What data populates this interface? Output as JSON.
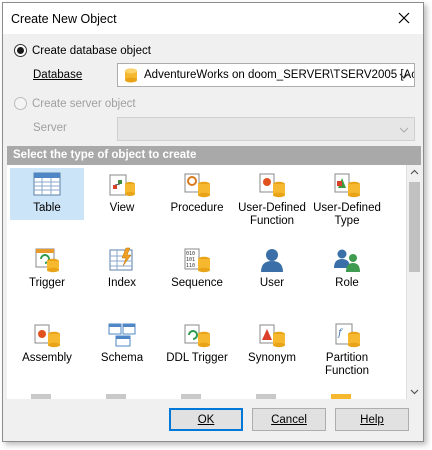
{
  "window": {
    "title": "Create New Object"
  },
  "options": {
    "database_object_label": "Create database object",
    "database_label": "Database",
    "database_value": "AdventureWorks on doom_SERVER\\TSERV2005 [Ac",
    "server_object_label": "Create server object",
    "server_label": "Server",
    "server_value": ""
  },
  "object_types": {
    "header": "Select the type of object to create",
    "items": [
      {
        "label": "Table",
        "icon": "table-icon",
        "selected": true
      },
      {
        "label": "View",
        "icon": "view-icon"
      },
      {
        "label": "Procedure",
        "icon": "procedure-icon"
      },
      {
        "label": "User-Defined Function",
        "icon": "user-defined-function-icon"
      },
      {
        "label": "User-Defined Type",
        "icon": "user-defined-type-icon"
      },
      {
        "label": "Trigger",
        "icon": "trigger-icon"
      },
      {
        "label": "Index",
        "icon": "index-icon"
      },
      {
        "label": "Sequence",
        "icon": "sequence-icon"
      },
      {
        "label": "User",
        "icon": "user-icon"
      },
      {
        "label": "Role",
        "icon": "role-icon"
      },
      {
        "label": "Assembly",
        "icon": "assembly-icon"
      },
      {
        "label": "Schema",
        "icon": "schema-icon"
      },
      {
        "label": "DDL Trigger",
        "icon": "ddl-trigger-icon"
      },
      {
        "label": "Synonym",
        "icon": "synonym-icon"
      },
      {
        "label": "Partition Function",
        "icon": "partition-function-icon"
      }
    ]
  },
  "buttons": {
    "ok": "OK",
    "cancel": "Cancel",
    "help": "Help"
  },
  "colors": {
    "selection": "#cce4f7",
    "header_bar": "#a9a9a9",
    "default_button_border": "#0078d7"
  }
}
